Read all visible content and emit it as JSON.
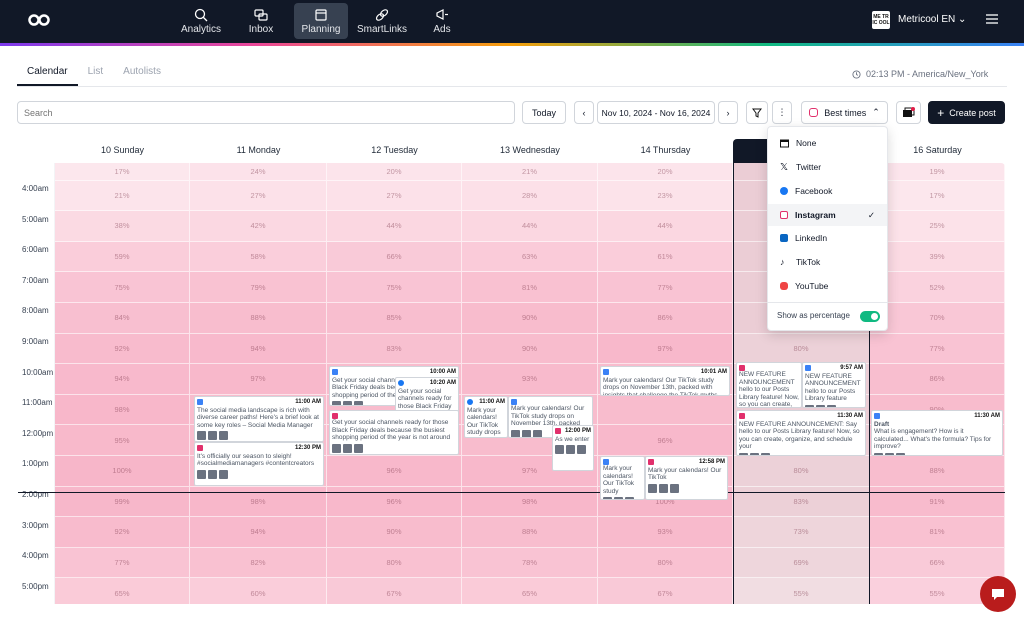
{
  "topbar": {
    "nav": [
      "Analytics",
      "Inbox",
      "Planning",
      "SmartLinks",
      "Ads"
    ],
    "brand_badge": "ME TR IC OOL",
    "brand_name": "Metricool EN"
  },
  "tabs": [
    "Calendar",
    "List",
    "Autolists"
  ],
  "clock": "02:13 PM - America/New_York",
  "toolbar": {
    "search_placeholder": "Search",
    "today": "Today",
    "range": "Nov 10, 2024 - Nov 16, 2024",
    "best_times": "Best times",
    "create": "Create post"
  },
  "days": [
    "10 Sunday",
    "11 Monday",
    "12 Tuesday",
    "13 Wednesday",
    "14 Thursday",
    "",
    "16 Saturday"
  ],
  "times": [
    "4:00am",
    "5:00am",
    "6:00am",
    "7:00am",
    "8:00am",
    "9:00am",
    "10:00am",
    "11:00am",
    "12:00pm",
    "1:00pm",
    "2:00pm",
    "3:00pm",
    "4:00pm",
    "5:00pm"
  ],
  "percent_rows": [
    [
      "17%",
      "24%",
      "20%",
      "21%",
      "20%",
      "",
      "19%"
    ],
    [
      "21%",
      "27%",
      "27%",
      "28%",
      "23%",
      "",
      "17%"
    ],
    [
      "38%",
      "42%",
      "44%",
      "44%",
      "44%",
      "",
      "25%"
    ],
    [
      "59%",
      "58%",
      "66%",
      "63%",
      "61%",
      "",
      "39%"
    ],
    [
      "75%",
      "79%",
      "75%",
      "81%",
      "77%",
      "",
      "52%"
    ],
    [
      "84%",
      "88%",
      "85%",
      "90%",
      "86%",
      "",
      "70%"
    ],
    [
      "92%",
      "94%",
      "83%",
      "90%",
      "97%",
      "80%",
      "77%"
    ],
    [
      "94%",
      "97%",
      "",
      "93%",
      "",
      "",
      "86%"
    ],
    [
      "98%",
      "",
      "",
      "",
      "",
      "",
      "90%"
    ],
    [
      "95%",
      "",
      "",
      "",
      "96%",
      "",
      ""
    ],
    [
      "100%",
      "",
      "96%",
      "97%",
      "",
      "80%",
      "88%"
    ],
    [
      "99%",
      "98%",
      "96%",
      "98%",
      "100%",
      "83%",
      "91%"
    ],
    [
      "92%",
      "94%",
      "90%",
      "88%",
      "93%",
      "73%",
      "81%"
    ],
    [
      "77%",
      "82%",
      "80%",
      "78%",
      "80%",
      "69%",
      "66%"
    ],
    [
      "65%",
      "60%",
      "67%",
      "65%",
      "67%",
      "55%",
      "55%"
    ]
  ],
  "posts": [
    {
      "time": "11:00 AM",
      "text": "The social media landscape is rich with diverse career paths! Here's a brief look at some key roles – Social Media Manager"
    },
    {
      "time": "12:30 PM",
      "text": "It's officially our season to sleigh! #socialmediamanagers #contentcreators"
    },
    {
      "time": "10:00 AM",
      "text": "Get your social channels ready for those Black Friday deals because the busiest shopping period of the year"
    },
    {
      "time": "10:20 AM",
      "text": "Get your social channels ready for those Black Friday"
    },
    {
      "time": "",
      "text": "Get your social channels ready for those Black Friday deals because the busiest shopping period of the year is not around"
    },
    {
      "time": "11:00 AM",
      "text": "Mark your calendars! Our TikTok study drops on November 13th"
    },
    {
      "time": "",
      "text": "Mark your calendars! Our TikTok study drops on November 13th, packed"
    },
    {
      "time": "12:00 PM",
      "text": "As we enter"
    },
    {
      "time": "10:01 AM",
      "text": "Mark your calendars! Our TikTok study drops on November 13th, packed with insights that challenge the TikTok myths"
    },
    {
      "time": "",
      "text": "Mark your calendars! Our TikTok study"
    },
    {
      "time": "12:58 PM",
      "text": "Mark your calendars! Our TikTok"
    },
    {
      "time": "",
      "text": "NEW FEATURE ANNOUNCEMENT hello to our Posts Library feature! Now, so you can create, organize"
    },
    {
      "time": "9:57 AM",
      "text": "NEW FEATURE ANNOUNCEMENT hello to our Posts Library feature"
    },
    {
      "time": "11:30 AM",
      "text": "NEW FEATURE ANNOUNCEMENT: Say hello to our Posts Library feature! Now, so you can create, organize, and schedule your"
    },
    {
      "time": "11:30 AM",
      "label": "Draft",
      "text": "What is engagement? How is it calculated... What's the formula? Tips for improve?"
    }
  ],
  "dropdown": {
    "items": [
      "None",
      "Twitter",
      "Facebook",
      "Instagram",
      "LinkedIn",
      "TikTok",
      "YouTube"
    ],
    "selected": "Instagram",
    "toggle_label": "Show as percentage"
  },
  "colors": {
    "topbar": "#111827",
    "accent": "#e1306c",
    "toggle": "#10b981",
    "chat": "#b91c1c"
  }
}
